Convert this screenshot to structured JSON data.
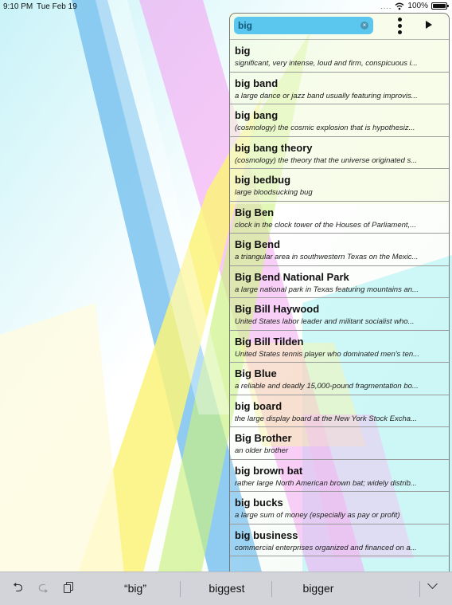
{
  "status_bar": {
    "time": "9:10 PM",
    "date": "Tue Feb 19",
    "signal": "....",
    "battery": "100%"
  },
  "search": {
    "value": "big",
    "placeholder": ""
  },
  "results": [
    {
      "word": "big",
      "definition": "significant, very intense, loud and firm, conspicuous i..."
    },
    {
      "word": "big band",
      "definition": "a large dance or jazz band usually featuring improvis..."
    },
    {
      "word": "big bang",
      "definition": "(cosmology) the cosmic explosion that is hypothesiz..."
    },
    {
      "word": "big bang theory",
      "definition": "(cosmology) the theory that the universe originated s..."
    },
    {
      "word": "big bedbug",
      "definition": "large bloodsucking bug"
    },
    {
      "word": "Big Ben",
      "definition": "clock in the clock tower of the Houses of Parliament,..."
    },
    {
      "word": "Big Bend",
      "definition": "a triangular area in southwestern Texas on the Mexic..."
    },
    {
      "word": "Big Bend National Park",
      "definition": "a large national park in Texas featuring mountains an..."
    },
    {
      "word": "Big Bill Haywood",
      "definition": "United States labor leader and militant socialist who..."
    },
    {
      "word": "Big Bill Tilden",
      "definition": "United States tennis player who dominated men's ten..."
    },
    {
      "word": "Big Blue",
      "definition": "a reliable and deadly 15,000-pound fragmentation bo..."
    },
    {
      "word": "big board",
      "definition": "the large display board at the New York Stock Excha..."
    },
    {
      "word": "Big Brother",
      "definition": "an older brother"
    },
    {
      "word": "big brown bat",
      "definition": "rather large North American brown bat; widely distrib..."
    },
    {
      "word": "big bucks",
      "definition": "a large sum of money (especially as pay or profit)"
    },
    {
      "word": "big business",
      "definition": "commercial enterprises organized and financed on a..."
    }
  ],
  "keyboard_bar": {
    "suggestions": [
      "“big”",
      "biggest",
      "bigger"
    ]
  },
  "icons": {
    "undo": "undo-icon",
    "redo": "redo-icon",
    "paste": "paste-icon",
    "clear": "clear-text-icon",
    "more": "more-vertical-icon",
    "play": "play-icon",
    "collapse": "chevron-down-icon"
  },
  "colors": {
    "search_field": "#5bc6ee",
    "keyboard_bar": "#d2d4d9"
  }
}
